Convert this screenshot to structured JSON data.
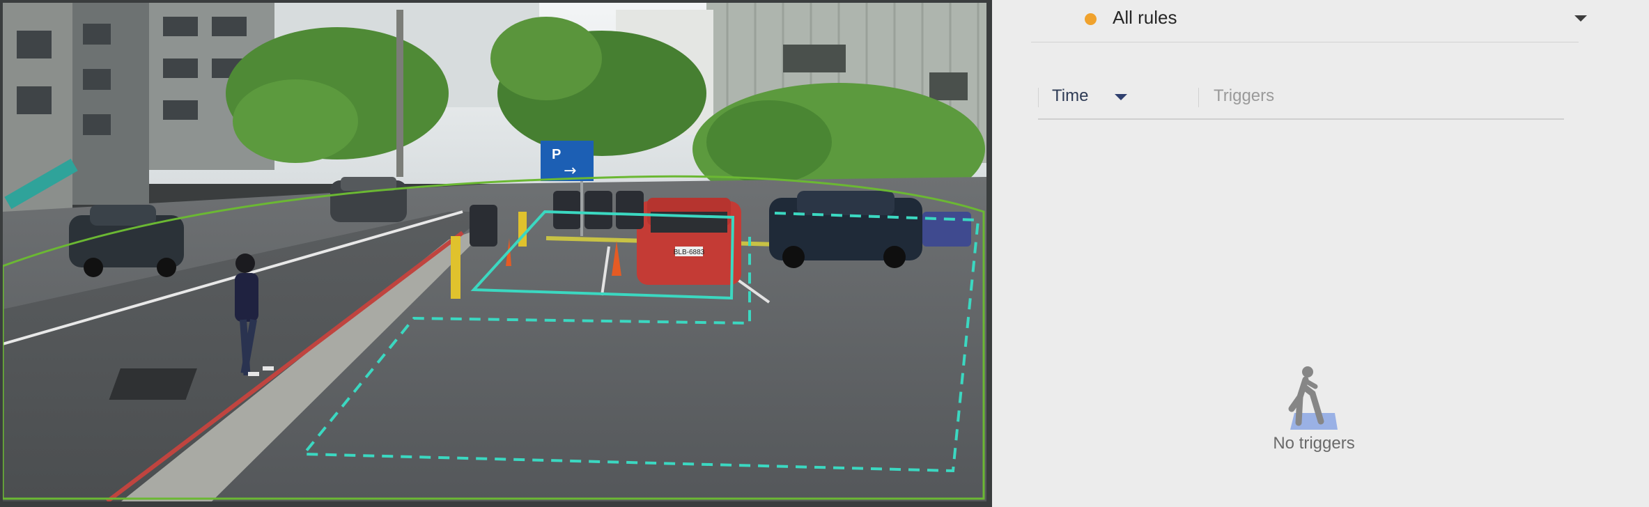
{
  "camera": {
    "sign_text": "P",
    "sign_arrow": "→",
    "plate_text": "BLB-6883"
  },
  "rules_dropdown": {
    "label": "All rules",
    "status_color": "#f0a22d"
  },
  "table": {
    "columns": [
      {
        "label": "Time",
        "sortable": true
      },
      {
        "label": "Triggers",
        "sortable": false
      }
    ]
  },
  "empty_state": {
    "icon": "person-walking-icon",
    "text": "No triggers"
  },
  "colors": {
    "zone_line": "#3bd8c1",
    "detection_line": "#6bb833",
    "accent_caret": "#2f3f6e"
  }
}
